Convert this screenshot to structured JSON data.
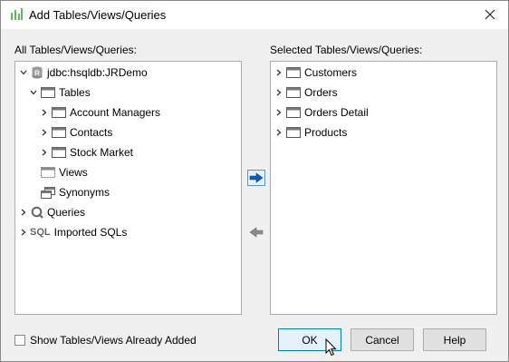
{
  "window": {
    "title": "Add Tables/Views/Queries"
  },
  "left_pane": {
    "label": "All Tables/Views/Queries:",
    "tree": {
      "root": "jdbc:hsqldb:JRDemo",
      "tables": "Tables",
      "table_items": [
        "Account Managers",
        "Contacts",
        "Stock Market"
      ],
      "views": "Views",
      "synonyms": "Synonyms",
      "queries": "Queries",
      "imported_sqls": "Imported SQLs",
      "sql_badge": "SQL",
      "db_badge": "R"
    }
  },
  "right_pane": {
    "label": "Selected Tables/Views/Queries:",
    "items": [
      "Customers",
      "Orders",
      "Orders Detail",
      "Products"
    ]
  },
  "footer": {
    "show_added_label": "Show Tables/Views Already Added",
    "ok": "OK",
    "cancel": "Cancel",
    "help": "Help"
  },
  "colors": {
    "arrow_active": "#0a5fb8",
    "arrow_disabled": "#8c8c8c",
    "focus": "#0078d7",
    "app_icon": "#5cb85c"
  }
}
